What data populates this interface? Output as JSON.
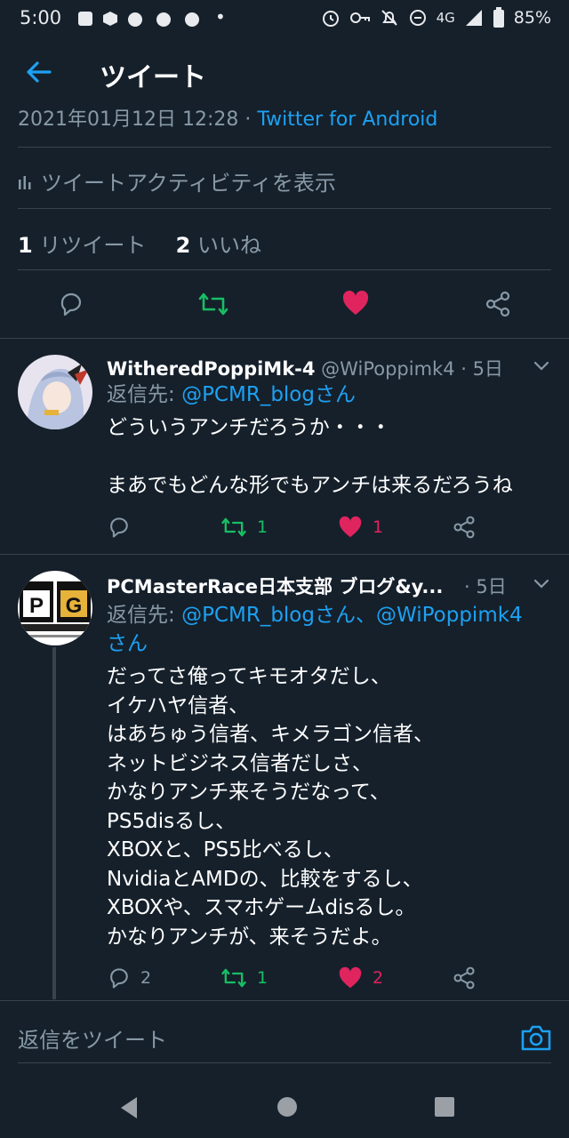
{
  "status_bar": {
    "time": "5:00",
    "network": "4G",
    "battery": "85%"
  },
  "appbar": {
    "title": "ツイート"
  },
  "main_tweet": {
    "timestamp": "2021年01月12日 12:28 · ",
    "source": "Twitter for Android",
    "activity_label": "ツイートアクティビティを表示",
    "retweet_count": "1",
    "retweet_label": " リツイート",
    "like_count": "2",
    "like_label": " いいね"
  },
  "replies": [
    {
      "name": "WitheredPoppiMk-4",
      "handle": " @WiPoppimk4 · 5日",
      "reply_prefix": "返信先: ",
      "reply_to_1": "@PCMR_blogさん",
      "body": "どういうアンチだろうか・・・\n\nまあでもどんな形でもアンチは来るだろうね",
      "reply_count": "",
      "retweet_count": "1",
      "like_count": "1"
    },
    {
      "name": "PCMasterRace日本支部 ブログ&y...",
      "handle": " · 5日",
      "reply_prefix": "返信先: ",
      "reply_to_1": "@PCMR_blogさん、@WiPoppimk4",
      "reply_to_2": "さん",
      "body": "だってさ俺ってキモオタだし、\nイケハヤ信者、\nはあちゅう信者、キメラゴン信者、\nネットビジネス信者だしさ、\nかなりアンチ来そうだなって、\nPS5disるし、\nXBOXと、PS5比べるし、\nNvidiaとAMDの、比較をするし、\nXBOXや、スマホゲームdisるし。\nかなりアンチが、来そうだよ。",
      "reply_count": "2",
      "retweet_count": "1",
      "like_count": "2"
    }
  ],
  "reply_composer": {
    "placeholder": "返信をツイート"
  },
  "colors": {
    "background": "#15202b",
    "accent": "#1da1f2",
    "retweet": "#17bf63",
    "like": "#e0245e",
    "muted": "#8899a6",
    "divider": "#38444d"
  },
  "icons": [
    "back-arrow-icon",
    "bar-chart-icon",
    "reply-icon",
    "retweet-icon",
    "heart-icon",
    "share-icon",
    "chevron-down-icon",
    "camera-icon",
    "nav-back-icon",
    "nav-home-icon",
    "nav-recents-icon"
  ]
}
